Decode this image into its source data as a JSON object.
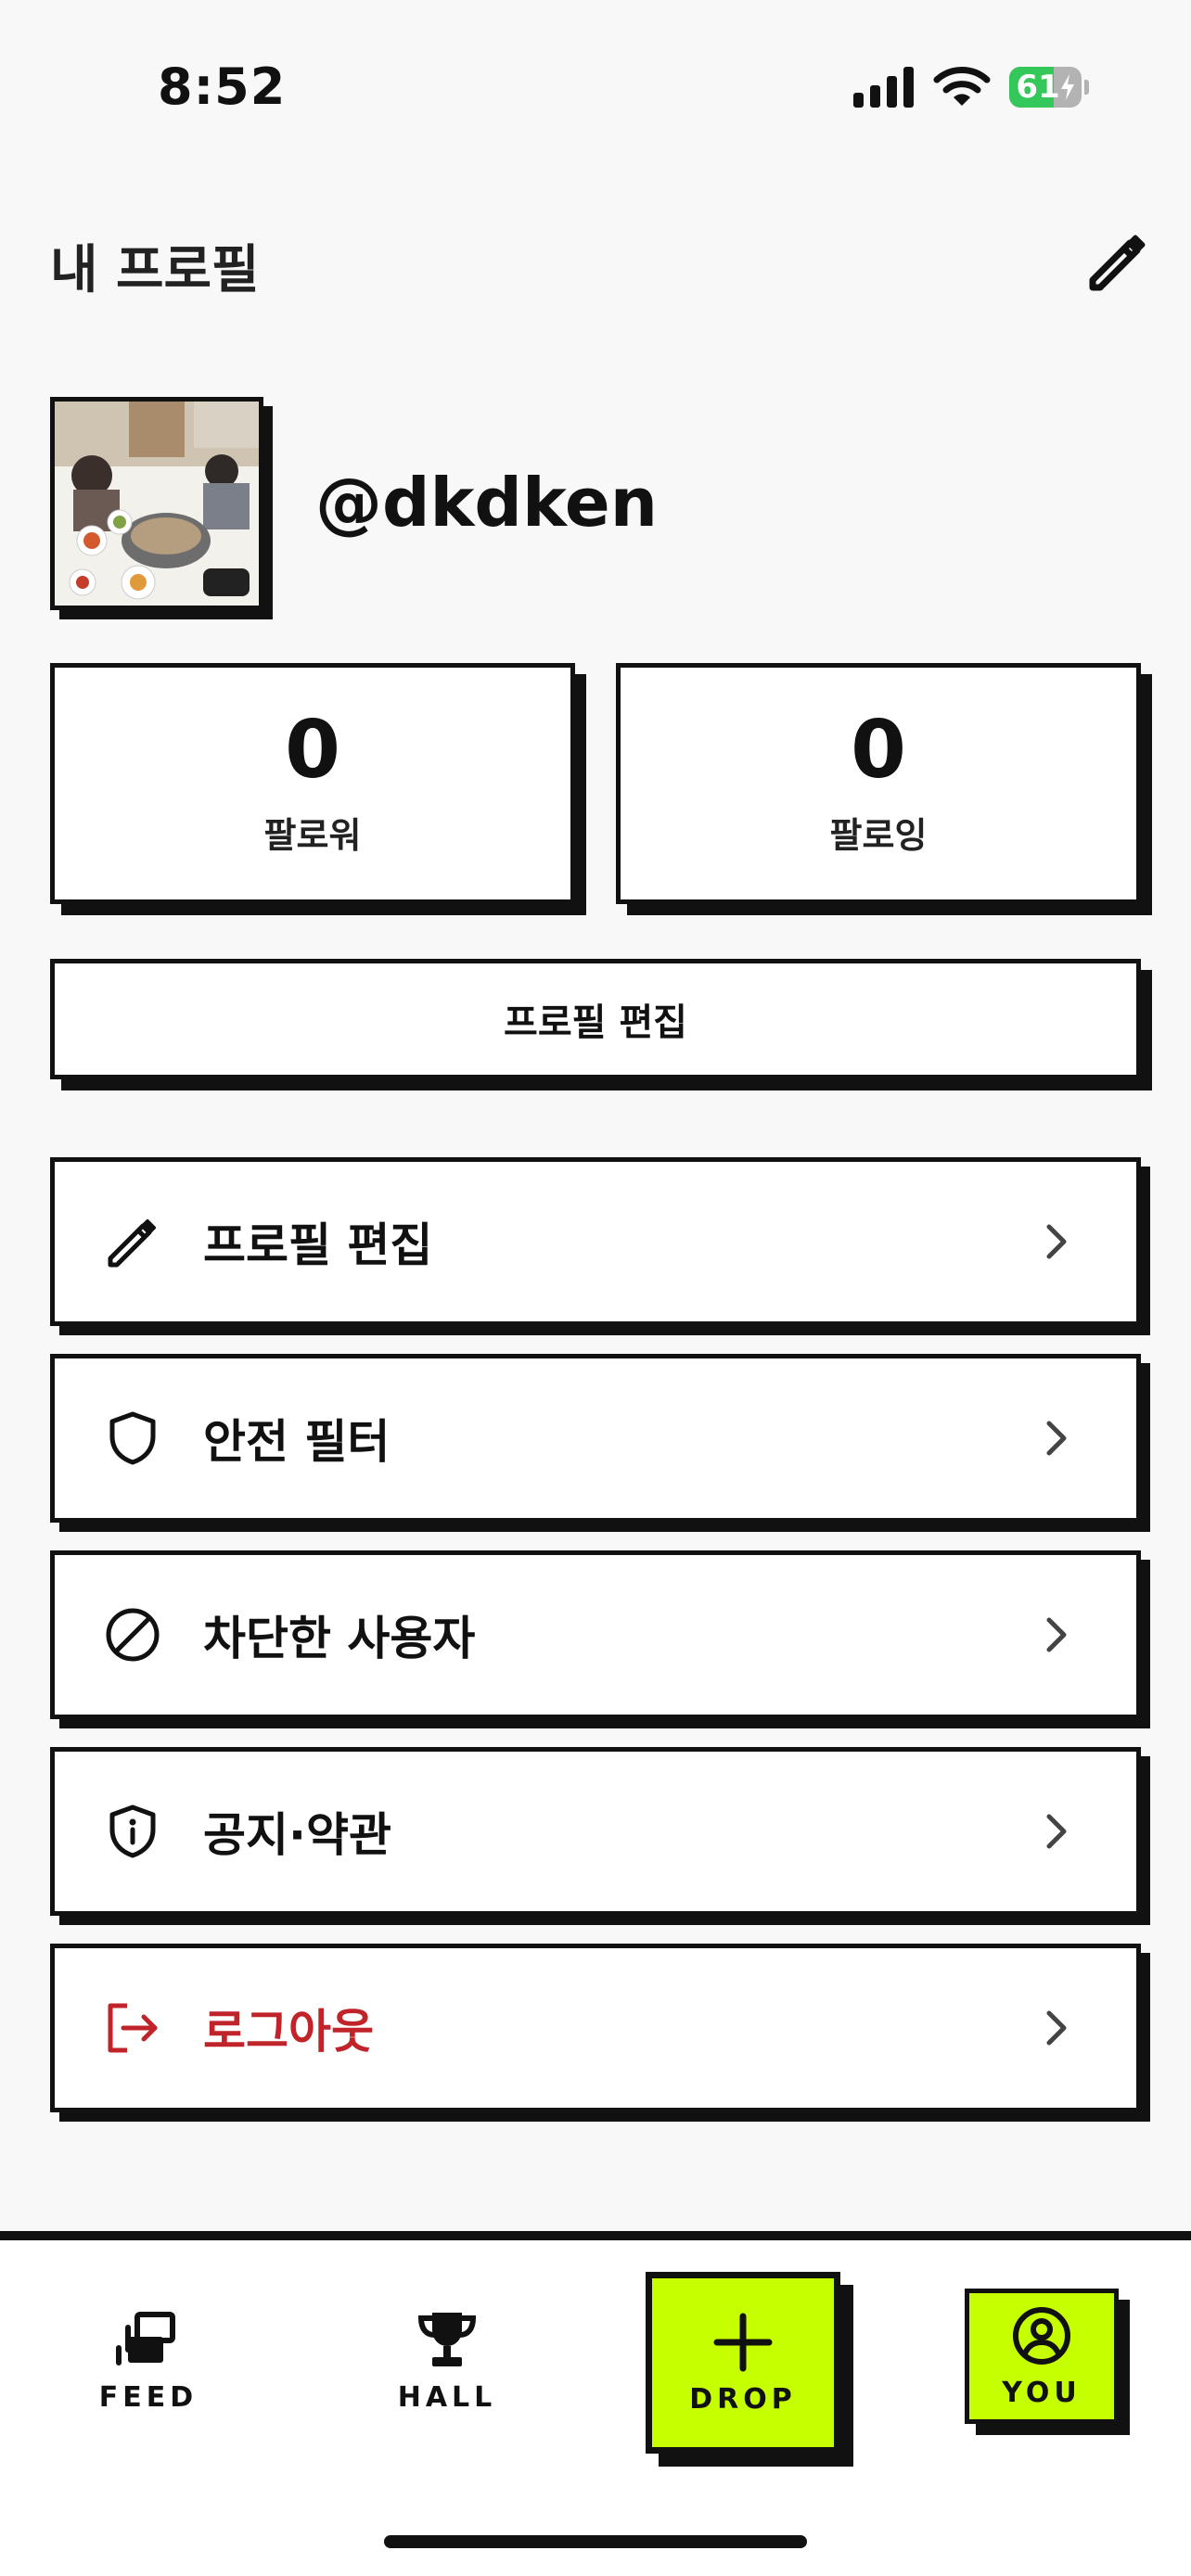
{
  "status_bar": {
    "time": "8:52",
    "battery": "61",
    "battery_level": 0.61
  },
  "header": {
    "title": "내 프로필"
  },
  "profile": {
    "username": "@dkdken"
  },
  "stats": {
    "followers": {
      "value": "0",
      "label": "팔로워"
    },
    "following": {
      "value": "0",
      "label": "팔로잉"
    }
  },
  "edit_profile_button": {
    "label": "프로필 편집"
  },
  "menu": [
    {
      "label": "프로필 편집",
      "icon": "pencil-icon"
    },
    {
      "label": "안전 필터",
      "icon": "shield-icon"
    },
    {
      "label": "차단한 사용자",
      "icon": "block-icon"
    },
    {
      "label": "공지·약관",
      "icon": "shield-info-icon"
    },
    {
      "label": "로그아웃",
      "icon": "logout-icon",
      "color": "#c0242a"
    }
  ],
  "tabs": [
    {
      "label": "FEED",
      "icon": "stacked-cards-icon"
    },
    {
      "label": "HALL",
      "icon": "trophy-icon"
    },
    {
      "label": "DROP",
      "icon": "plus-icon"
    },
    {
      "label": "YOU",
      "icon": "user-circle-icon"
    }
  ],
  "colors": {
    "accent": "#c6ff00",
    "danger": "#c0242a",
    "ink": "#111111",
    "background": "#f8f8f8"
  }
}
